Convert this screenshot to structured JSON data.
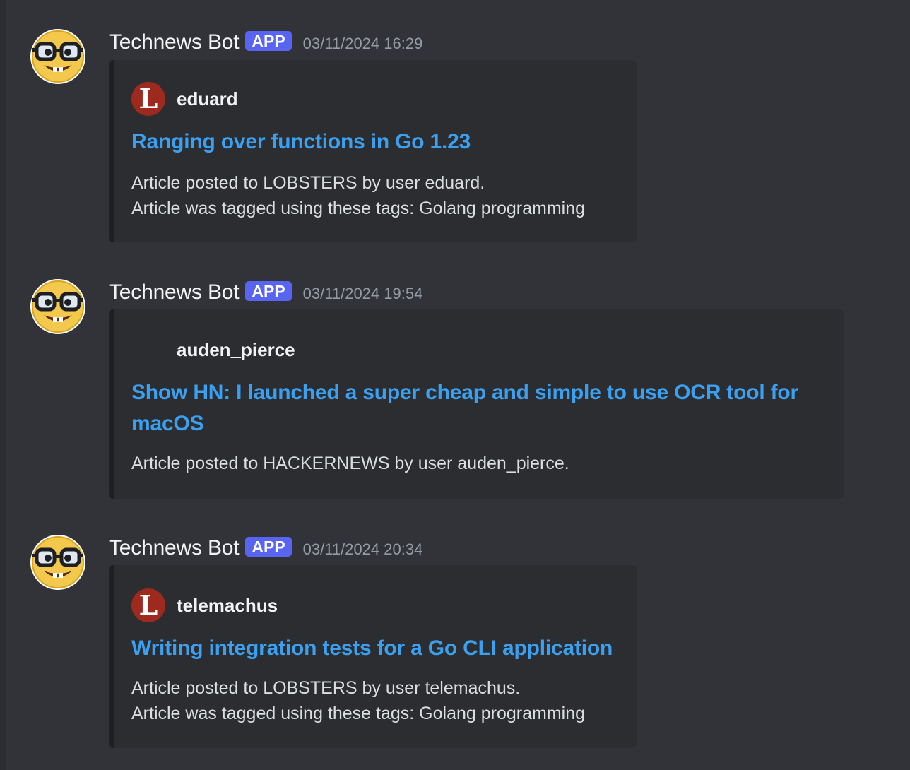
{
  "messages": [
    {
      "author": "Technews Bot",
      "badge": "APP",
      "timestamp": "03/11/2024 16:29",
      "embed": {
        "author_name": "eduard",
        "icon_letter": "L",
        "icon_name": "lobsters-icon",
        "title": "Ranging over functions in Go 1.23",
        "description": [
          "Article posted to LOBSTERS by user eduard.",
          "Article was tagged using these tags: Golang programming"
        ]
      }
    },
    {
      "author": "Technews Bot",
      "badge": "APP",
      "timestamp": "03/11/2024 19:54",
      "embed": {
        "author_name": "auden_pierce",
        "icon_letter": "",
        "icon_name": "blank-icon",
        "title_lines": [
          "Show HN: I launched a super cheap and simple to use OCR tool for",
          "macOS"
        ],
        "description": [
          "Article posted to HACKERNEWS by user auden_pierce."
        ]
      }
    },
    {
      "author": "Technews Bot",
      "badge": "APP",
      "timestamp": "03/11/2024 20:34",
      "embed": {
        "author_name": "telemachus",
        "icon_letter": "L",
        "icon_name": "lobsters-icon",
        "title": "Writing integration tests for a Go CLI application",
        "description": [
          "Article posted to LOBSTERS by user telemachus.",
          "Article was tagged using these tags: Golang programming"
        ]
      }
    }
  ],
  "colors": {
    "background": "#313338",
    "embed_background": "#2b2d31",
    "link": "#3ba0f0",
    "badge": "#5865f2",
    "lobsters_red": "#9e2a1f"
  }
}
